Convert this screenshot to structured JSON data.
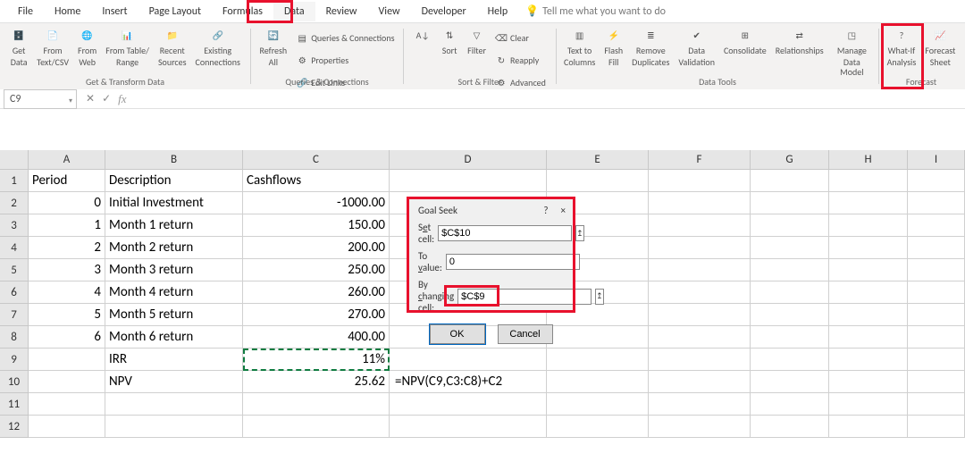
{
  "menu": [
    "File",
    "Home",
    "Insert",
    "Page Layout",
    "Formulas",
    "Data",
    "Review",
    "View",
    "Developer",
    "Help"
  ],
  "tell_me": "Tell me what you want to do",
  "ribbon": {
    "groups": {
      "get_transform": {
        "label": "Get & Transform Data",
        "buttons": [
          {
            "id": "get-data",
            "l1": "Get",
            "l2": "Data"
          },
          {
            "id": "from-textcsv",
            "l1": "From",
            "l2": "Text/CSV"
          },
          {
            "id": "from-web",
            "l1": "From",
            "l2": "Web"
          },
          {
            "id": "from-table",
            "l1": "From Table/",
            "l2": "Range"
          },
          {
            "id": "recent-sources",
            "l1": "Recent",
            "l2": "Sources"
          },
          {
            "id": "existing-conn",
            "l1": "Existing",
            "l2": "Connections"
          }
        ]
      },
      "queries_conn": {
        "label": "Queries & Connections",
        "refresh": {
          "l1": "Refresh",
          "l2": "All"
        },
        "rows": [
          {
            "id": "queries-conn",
            "label": "Queries & Connections"
          },
          {
            "id": "properties",
            "label": "Properties"
          },
          {
            "id": "edit-links",
            "label": "Edit Links"
          }
        ]
      },
      "sort_filter": {
        "label": "Sort & Filter",
        "sort": "Sort",
        "filter": "Filter",
        "rows": [
          {
            "id": "clear",
            "label": "Clear"
          },
          {
            "id": "reapply",
            "label": "Reapply"
          },
          {
            "id": "advanced",
            "label": "Advanced"
          }
        ]
      },
      "data_tools": {
        "label": "Data Tools",
        "buttons": [
          {
            "id": "text-to-columns",
            "l1": "Text to",
            "l2": "Columns"
          },
          {
            "id": "flash-fill",
            "l1": "Flash",
            "l2": "Fill"
          },
          {
            "id": "remove-dup",
            "l1": "Remove",
            "l2": "Duplicates"
          },
          {
            "id": "data-validation",
            "l1": "Data",
            "l2": "Validation"
          },
          {
            "id": "consolidate",
            "l1": "Consolidate",
            "l2": ""
          },
          {
            "id": "relationships",
            "l1": "Relationships",
            "l2": ""
          },
          {
            "id": "data-model",
            "l1": "Manage",
            "l2": "Data Model"
          }
        ]
      },
      "forecast": {
        "label": "Forecast",
        "buttons": [
          {
            "id": "what-if",
            "l1": "What-If",
            "l2": "Analysis"
          },
          {
            "id": "forecast-sheet",
            "l1": "Forecast",
            "l2": "Sheet"
          }
        ]
      }
    }
  },
  "namebox": "C9",
  "sheet": {
    "headers": {
      "A": "Period",
      "B": "Description",
      "C": "Cashflows"
    },
    "rows": [
      {
        "A": "0",
        "B": "Initial Investment",
        "C": "-1000.00"
      },
      {
        "A": "1",
        "B": "Month 1 return",
        "C": "150.00"
      },
      {
        "A": "2",
        "B": "Month 2 return",
        "C": "200.00"
      },
      {
        "A": "3",
        "B": "Month 3 return",
        "C": "250.00"
      },
      {
        "A": "4",
        "B": "Month 4 return",
        "C": "260.00"
      },
      {
        "A": "5",
        "B": "Month 5 return",
        "C": "270.00"
      },
      {
        "A": "6",
        "B": "Month 6 return",
        "C": "400.00"
      },
      {
        "A": "",
        "B": "IRR",
        "C": "11%"
      },
      {
        "A": "",
        "B": "NPV",
        "C": "25.62"
      }
    ],
    "formula_d10": "=NPV(C9,C3:C8)+C2"
  },
  "dialog": {
    "title": "Goal Seek",
    "help": "?",
    "close": "×",
    "set_cell_label": "Set cell:",
    "set_cell_value": "$C$10",
    "to_value_label": "To value:",
    "to_value_value": "0",
    "by_changing_label": "By changing cell:",
    "by_changing_value": "$C$9",
    "ok": "OK",
    "cancel": "Cancel"
  },
  "chart_data": {
    "type": "table",
    "title": "Cashflows",
    "columns": [
      "Period",
      "Description",
      "Cashflows"
    ],
    "rows": [
      [
        0,
        "Initial Investment",
        -1000.0
      ],
      [
        1,
        "Month 1 return",
        150.0
      ],
      [
        2,
        "Month 2 return",
        200.0
      ],
      [
        3,
        "Month 3 return",
        250.0
      ],
      [
        4,
        "Month 4 return",
        260.0
      ],
      [
        5,
        "Month 5 return",
        270.0
      ],
      [
        6,
        "Month 6 return",
        400.0
      ],
      [
        null,
        "IRR",
        "11%"
      ],
      [
        null,
        "NPV",
        25.62
      ]
    ]
  }
}
